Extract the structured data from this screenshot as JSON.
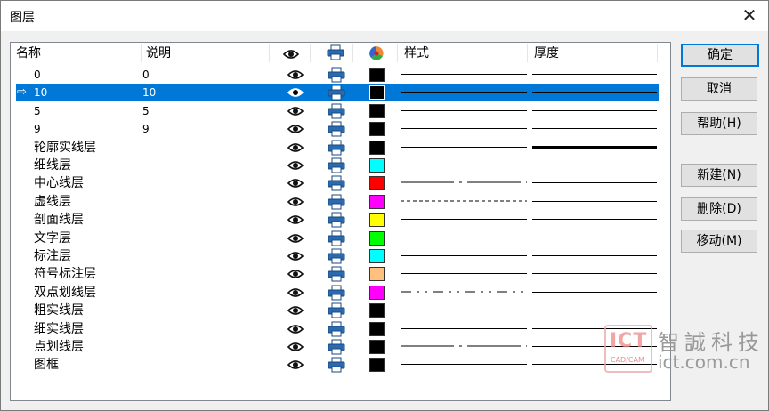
{
  "window": {
    "title": "图层",
    "close_glyph": "✕"
  },
  "columns": {
    "name": "名称",
    "desc": "说明",
    "visible_icon": "eye-icon",
    "print_icon": "printer-icon",
    "color_icon": "color-wheel-icon",
    "style": "样式",
    "thickness": "厚度"
  },
  "layers": [
    {
      "name": "0",
      "desc": "0",
      "color": "#000000",
      "line": "solid",
      "thick": false
    },
    {
      "name": "10",
      "desc": "10",
      "color": "#000000",
      "line": "solid",
      "thick": false,
      "selected": true,
      "marker": "⇨"
    },
    {
      "name": "5",
      "desc": "5",
      "color": "#000000",
      "line": "solid",
      "thick": false
    },
    {
      "name": "9",
      "desc": "9",
      "color": "#000000",
      "line": "solid",
      "thick": false
    },
    {
      "name": "轮廓实线层",
      "desc": "",
      "color": "#000000",
      "line": "solid",
      "thick": true
    },
    {
      "name": "细线层",
      "desc": "",
      "color": "#00ffff",
      "line": "solid",
      "thick": false
    },
    {
      "name": "中心线层",
      "desc": "",
      "color": "#ff0000",
      "line": "dashdot",
      "thick": false
    },
    {
      "name": "虚线层",
      "desc": "",
      "color": "#ff00ff",
      "line": "dashed",
      "thick": false
    },
    {
      "name": "剖面线层",
      "desc": "",
      "color": "#ffff00",
      "line": "solid",
      "thick": false
    },
    {
      "name": "文字层",
      "desc": "",
      "color": "#00ff00",
      "line": "solid",
      "thick": false
    },
    {
      "name": "标注层",
      "desc": "",
      "color": "#00ffff",
      "line": "solid",
      "thick": false
    },
    {
      "name": "符号标注层",
      "desc": "",
      "color": "#ffc080",
      "line": "solid",
      "thick": false
    },
    {
      "name": "双点划线层",
      "desc": "",
      "color": "#ff00ff",
      "line": "dashdotdot",
      "thick": false
    },
    {
      "name": "粗实线层",
      "desc": "",
      "color": "#000000",
      "line": "solid",
      "thick": false
    },
    {
      "name": "细实线层",
      "desc": "",
      "color": "#000000",
      "line": "solid",
      "thick": false
    },
    {
      "name": "点划线层",
      "desc": "",
      "color": "#000000",
      "line": "dashdot",
      "thick": false
    },
    {
      "name": "图框",
      "desc": "",
      "color": "#000000",
      "line": "solid",
      "thick": false
    }
  ],
  "buttons": {
    "ok": "确定",
    "cancel": "取消",
    "help": "帮助(H)",
    "new": "新建(N)",
    "delete": "删除(D)",
    "move": "移动(M)"
  },
  "watermark": {
    "logo": "ICT",
    "logo_sub": "CAD/CAM",
    "name": "智誠科技",
    "url": "ict.com.cn"
  }
}
